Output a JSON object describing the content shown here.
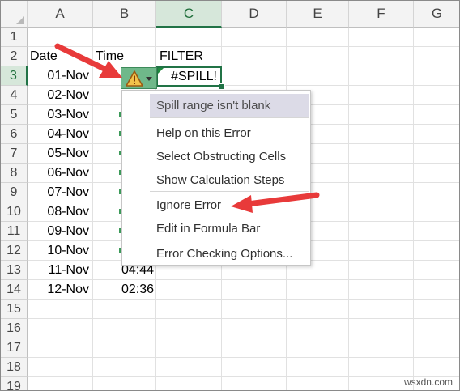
{
  "columns": [
    "A",
    "B",
    "C",
    "D",
    "E",
    "F",
    "G"
  ],
  "rows": [
    "1",
    "2",
    "3",
    "4",
    "5",
    "6",
    "7",
    "8",
    "9",
    "10",
    "11",
    "12",
    "13",
    "14",
    "15",
    "16",
    "17",
    "18",
    "19"
  ],
  "headers": {
    "date": "Date",
    "time": "Time",
    "filter": "FILTER"
  },
  "dates": [
    "01-Nov",
    "02-Nov",
    "03-Nov",
    "04-Nov",
    "05-Nov",
    "06-Nov",
    "07-Nov",
    "08-Nov",
    "09-Nov",
    "10-Nov",
    "11-Nov",
    "12-Nov"
  ],
  "times": {
    "row13": "04:44",
    "row14": "02:36"
  },
  "spill_value": "#SPILL!",
  "error_menu": {
    "title": "Spill range isn't blank",
    "items": [
      "Help on this Error",
      "Select Obstructing Cells",
      "Show Calculation Steps",
      "Ignore Error",
      "Edit in Formula Bar",
      "Error Checking Options..."
    ]
  },
  "watermark": "wsxdn.com",
  "colors": {
    "accent": "#217346",
    "arrow": "#e83a3a",
    "warn_button": "#6fb88a"
  },
  "icons": [
    "warning-icon",
    "dropdown-caret-icon",
    "annotation-arrow"
  ]
}
